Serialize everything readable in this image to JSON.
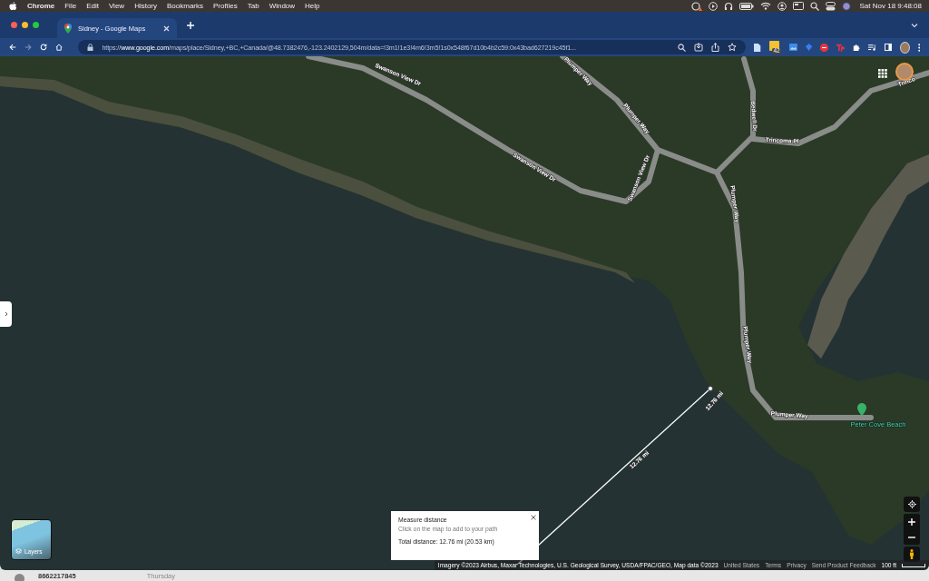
{
  "menu_bar": {
    "app": "Chrome",
    "menus": [
      "File",
      "Edit",
      "View",
      "History",
      "Bookmarks",
      "Profiles",
      "Tab",
      "Window",
      "Help"
    ],
    "clock": "Sat Nov 18  9:48:08"
  },
  "tabs": [
    {
      "title": "Sidney - Google Maps",
      "selected": true
    }
  ],
  "address_bar": {
    "url": "https://**www.google.com**/maps/place/Sidney,+BC,+Canada/@48.7382476,-123.2402129,504m/data=!3m1!1e3!4m6!3m5!1s0x548f67d10b4b2c59:0x43bad627219c45f1..."
  },
  "extensions": {
    "badge": "42"
  },
  "map": {
    "road_labels": [
      {
        "text": "Swanson View Dr"
      },
      {
        "text": "Swanson View Dr"
      },
      {
        "text": "Swanson View Dr"
      },
      {
        "text": "Plumper Way"
      },
      {
        "text": "Plumper Way"
      },
      {
        "text": "Plumper Way"
      },
      {
        "text": "Plumper Way"
      },
      {
        "text": "Plumper Way"
      },
      {
        "text": "Bedwell Dr"
      },
      {
        "text": "Trincoma Pl"
      },
      {
        "text": "Trinco"
      }
    ],
    "places": [
      {
        "name": "Peter Cove Beach"
      }
    ],
    "measure_labels": [
      "12.76 mi",
      "12.76 mi"
    ],
    "layers_button": "Layers",
    "measure_card": {
      "title": "Measure distance",
      "hint": "Click on the map to add to your path",
      "total": "Total distance: 12.76 mi (20.53 km)"
    },
    "attribution": {
      "imagery": "Imagery ©2023 Airbus, Maxar Technologies, U.S. Geological Survey, USDA/FPAC/GEO, Map data ©2023",
      "links": [
        "United States",
        "Terms",
        "Privacy",
        "Send Product Feedback"
      ],
      "scale": "100 ft"
    }
  },
  "background_window": {
    "phone": "8662217845",
    "day": "Thursday"
  }
}
